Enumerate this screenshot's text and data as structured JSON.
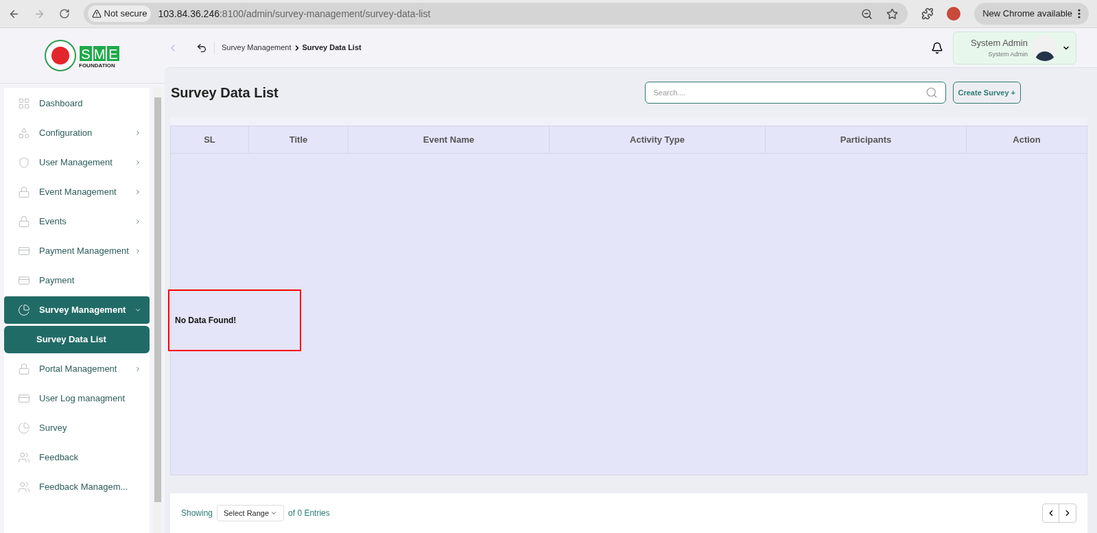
{
  "browser": {
    "security": "Not secure",
    "url_host": "103.84.36.246",
    "url_path": ":8100/admin/survey-management/survey-data-list",
    "update": "New Chrome available"
  },
  "logo": {
    "brand": "SME",
    "sub": "FOUNDATION"
  },
  "breadcrumb": {
    "parent": "Survey Management",
    "current": "Survey Data List"
  },
  "user": {
    "name": "System Admin",
    "role": "System Admin"
  },
  "sidebar": {
    "items": [
      {
        "label": "Dashboard",
        "kind": "grid",
        "has_arrow": false,
        "selected": false
      },
      {
        "label": "Configuration",
        "kind": "config",
        "has_arrow": true,
        "selected": false
      },
      {
        "label": "User Management",
        "kind": "shield",
        "has_arrow": true,
        "selected": false
      },
      {
        "label": "Event Management",
        "kind": "lock",
        "has_arrow": true,
        "selected": false
      },
      {
        "label": "Events",
        "kind": "lock",
        "has_arrow": true,
        "selected": false
      },
      {
        "label": "Payment Management",
        "kind": "card",
        "has_arrow": true,
        "selected": false
      },
      {
        "label": "Payment",
        "kind": "card",
        "has_arrow": false,
        "selected": false
      },
      {
        "label": "Survey Management",
        "kind": "pie",
        "has_arrow": true,
        "selected": true,
        "expanded": true,
        "children": [
          {
            "label": "Survey Data List",
            "selected": true
          }
        ]
      },
      {
        "label": "Portal Management",
        "kind": "lock",
        "has_arrow": true,
        "selected": false
      },
      {
        "label": "User Log managment",
        "kind": "card",
        "has_arrow": false,
        "selected": false
      },
      {
        "label": "Survey",
        "kind": "pie",
        "has_arrow": false,
        "selected": false
      },
      {
        "label": "Feedback",
        "kind": "people",
        "has_arrow": false,
        "selected": false
      },
      {
        "label": "Feedback Managem...",
        "kind": "people",
        "has_arrow": false,
        "selected": false
      }
    ]
  },
  "page": {
    "title": "Survey Data List",
    "search": {
      "placeholder": "Search...."
    },
    "create_button": "Create Survey +"
  },
  "table": {
    "columns": [
      "SL",
      "Title",
      "Event Name",
      "Activity Type",
      "Participants",
      "Action"
    ],
    "empty_message": "No Data Found!"
  },
  "footer": {
    "showing": "Showing",
    "range": "Select Range",
    "entries": "of 0 Entries"
  }
}
